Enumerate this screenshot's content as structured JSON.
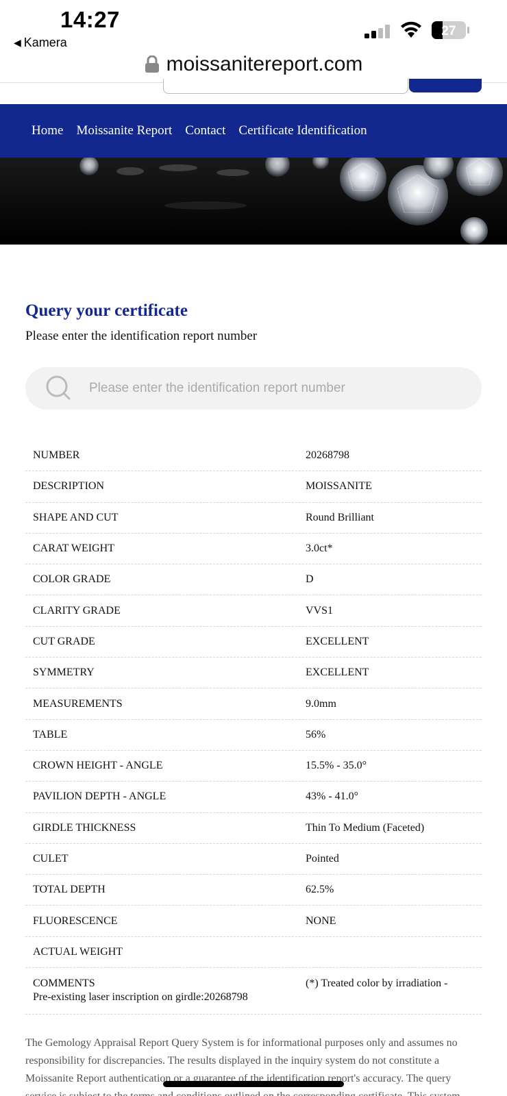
{
  "status_bar": {
    "time": "14:27",
    "back_label": "Kamera",
    "battery": "27"
  },
  "browser": {
    "url": "moissanitereport.com"
  },
  "nav": {
    "items": [
      {
        "label": "Home"
      },
      {
        "label": "Moissanite Report"
      },
      {
        "label": "Contact"
      },
      {
        "label": "Certificate Identification"
      }
    ]
  },
  "query": {
    "title": "Query your certificate",
    "subtitle": "Please enter the identification report number",
    "search_placeholder": "Please enter the identification report number",
    "search_value": ""
  },
  "report": {
    "rows": [
      {
        "label": "NUMBER",
        "value": "20268798"
      },
      {
        "label": "DESCRIPTION",
        "value": "MOISSANITE"
      },
      {
        "label": "SHAPE AND CUT",
        "value": "Round Brilliant"
      },
      {
        "label": "CARAT WEIGHT",
        "value": "3.0ct*"
      },
      {
        "label": "COLOR GRADE",
        "value": "D"
      },
      {
        "label": "CLARITY GRADE",
        "value": "VVS1"
      },
      {
        "label": "CUT GRADE",
        "value": "EXCELLENT"
      },
      {
        "label": "SYMMETRY",
        "value": "EXCELLENT"
      },
      {
        "label": "MEASUREMENTS",
        "value": "9.0mm"
      },
      {
        "label": "TABLE",
        "value": "56%"
      },
      {
        "label": "CROWN HEIGHT - ANGLE",
        "value": "15.5% - 35.0°"
      },
      {
        "label": "PAVILION DEPTH - ANGLE",
        "value": "43% - 41.0°"
      },
      {
        "label": "GIRDLE THICKNESS",
        "value": "Thin To Medium (Faceted)"
      },
      {
        "label": "CULET",
        "value": "Pointed"
      },
      {
        "label": "TOTAL DEPTH",
        "value": "62.5%"
      },
      {
        "label": "FLUORESCENCE",
        "value": "NONE"
      },
      {
        "label": "ACTUAL WEIGHT",
        "value": ""
      }
    ],
    "comments": {
      "label": "COMMENTS",
      "value": "(*) Treated color by irradiation -",
      "extra": "Pre-existing laser inscription on girdle:20268798"
    }
  },
  "disclaimer": "The Gemology Appraisal Report Query System is for informational purposes only and assumes no responsibility for discrepancies. The results displayed in the inquiry system do not constitute a Moissanite Report authentication or a guarantee of the identification report's accuracy. The query service is subject to the terms and conditions outlined on the corresponding certificate. This system",
  "colors": {
    "brand_blue": "#12288f",
    "title_blue": "#12288f"
  }
}
